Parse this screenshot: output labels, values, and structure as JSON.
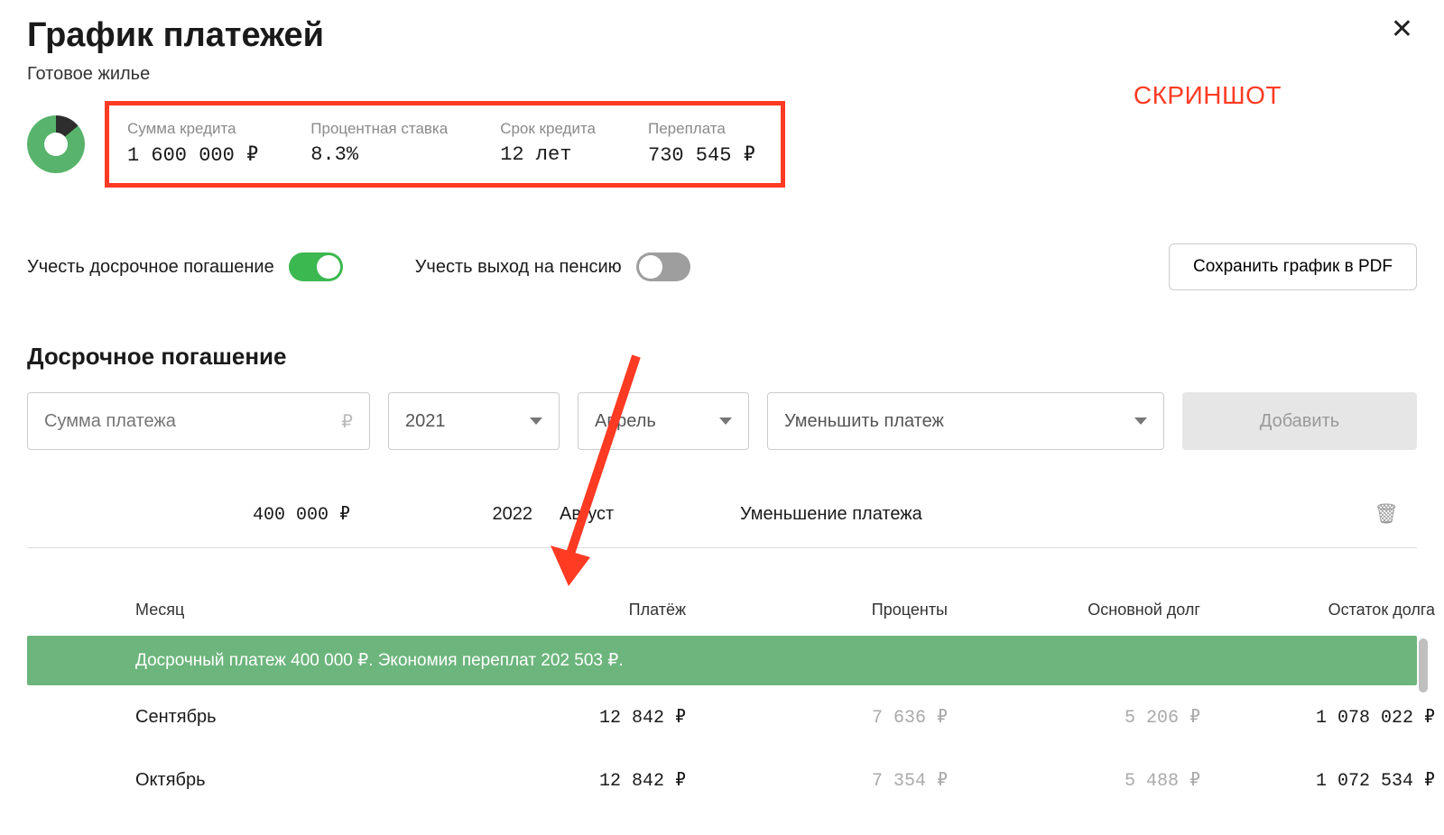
{
  "header": {
    "title": "График платежей",
    "subtitle": "Готовое жилье"
  },
  "annotation_label": "СКРИНШОТ",
  "summary": {
    "loan_amount": {
      "label": "Сумма кредита",
      "value": "1 600 000 ₽"
    },
    "rate": {
      "label": "Процентная ставка",
      "value": "8.3%"
    },
    "term": {
      "label": "Срок кредита",
      "value": "12 лет"
    },
    "overpay": {
      "label": "Переплата",
      "value": "730 545 ₽"
    }
  },
  "toggles": {
    "early": {
      "label": "Учесть досрочное погашение",
      "on": true
    },
    "pension": {
      "label": "Учесть выход на пенсию",
      "on": false
    }
  },
  "buttons": {
    "save_pdf": "Сохранить график в PDF",
    "add": "Добавить"
  },
  "section": {
    "early_title": "Досрочное погашение"
  },
  "form": {
    "amount_placeholder": "Сумма платежа",
    "year": "2021",
    "month": "Апрель",
    "action": "Уменьшить платеж"
  },
  "entry": {
    "amount": "400 000 ₽",
    "year": "2022",
    "month": "Август",
    "action": "Уменьшение платежа"
  },
  "table": {
    "headers": {
      "month": "Месяц",
      "payment": "Платёж",
      "interest": "Проценты",
      "principal": "Основной долг",
      "balance": "Остаток долга"
    },
    "banner": "Досрочный платеж 400 000 ₽. Экономия переплат 202 503 ₽.",
    "rows": [
      {
        "month": "Сентябрь",
        "payment": "12 842 ₽",
        "interest": "7 636 ₽",
        "principal": "5 206 ₽",
        "balance": "1 078 022 ₽"
      },
      {
        "month": "Октябрь",
        "payment": "12 842 ₽",
        "interest": "7 354 ₽",
        "principal": "5 488 ₽",
        "balance": "1 072 534 ₽"
      }
    ]
  }
}
